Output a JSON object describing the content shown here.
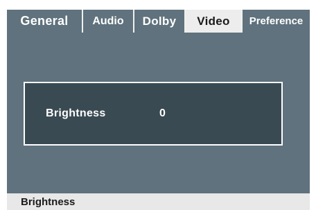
{
  "tabs": [
    {
      "label": "General",
      "active": false
    },
    {
      "label": "Audio",
      "active": false
    },
    {
      "label": "Dolby",
      "active": false
    },
    {
      "label": "Video",
      "active": true
    },
    {
      "label": "Preference",
      "active": false
    }
  ],
  "panel": {
    "label": "Brightness",
    "value": "0"
  },
  "status": {
    "text": "Brightness"
  },
  "colors": {
    "background": "#5f727d",
    "panel": "#394a53",
    "active_tab": "#ededed",
    "text": "#ffffff"
  }
}
